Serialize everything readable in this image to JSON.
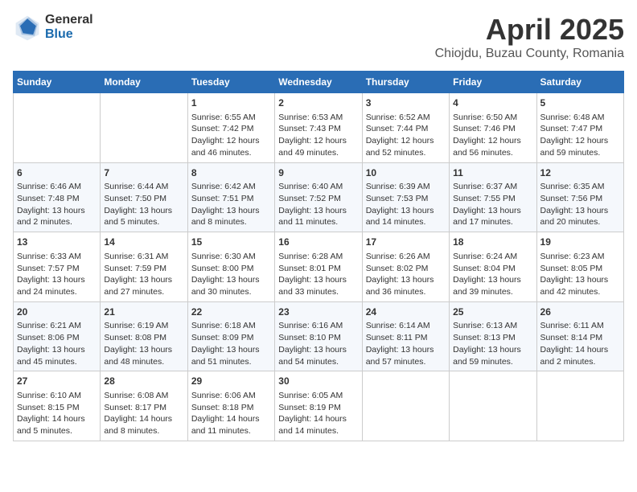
{
  "logo": {
    "general": "General",
    "blue": "Blue"
  },
  "title": {
    "month": "April 2025",
    "location": "Chiojdu, Buzau County, Romania"
  },
  "weekdays": [
    "Sunday",
    "Monday",
    "Tuesday",
    "Wednesday",
    "Thursday",
    "Friday",
    "Saturday"
  ],
  "weeks": [
    [
      {
        "day": "",
        "sunrise": "",
        "sunset": "",
        "daylight": ""
      },
      {
        "day": "",
        "sunrise": "",
        "sunset": "",
        "daylight": ""
      },
      {
        "day": "1",
        "sunrise": "Sunrise: 6:55 AM",
        "sunset": "Sunset: 7:42 PM",
        "daylight": "Daylight: 12 hours and 46 minutes."
      },
      {
        "day": "2",
        "sunrise": "Sunrise: 6:53 AM",
        "sunset": "Sunset: 7:43 PM",
        "daylight": "Daylight: 12 hours and 49 minutes."
      },
      {
        "day": "3",
        "sunrise": "Sunrise: 6:52 AM",
        "sunset": "Sunset: 7:44 PM",
        "daylight": "Daylight: 12 hours and 52 minutes."
      },
      {
        "day": "4",
        "sunrise": "Sunrise: 6:50 AM",
        "sunset": "Sunset: 7:46 PM",
        "daylight": "Daylight: 12 hours and 56 minutes."
      },
      {
        "day": "5",
        "sunrise": "Sunrise: 6:48 AM",
        "sunset": "Sunset: 7:47 PM",
        "daylight": "Daylight: 12 hours and 59 minutes."
      }
    ],
    [
      {
        "day": "6",
        "sunrise": "Sunrise: 6:46 AM",
        "sunset": "Sunset: 7:48 PM",
        "daylight": "Daylight: 13 hours and 2 minutes."
      },
      {
        "day": "7",
        "sunrise": "Sunrise: 6:44 AM",
        "sunset": "Sunset: 7:50 PM",
        "daylight": "Daylight: 13 hours and 5 minutes."
      },
      {
        "day": "8",
        "sunrise": "Sunrise: 6:42 AM",
        "sunset": "Sunset: 7:51 PM",
        "daylight": "Daylight: 13 hours and 8 minutes."
      },
      {
        "day": "9",
        "sunrise": "Sunrise: 6:40 AM",
        "sunset": "Sunset: 7:52 PM",
        "daylight": "Daylight: 13 hours and 11 minutes."
      },
      {
        "day": "10",
        "sunrise": "Sunrise: 6:39 AM",
        "sunset": "Sunset: 7:53 PM",
        "daylight": "Daylight: 13 hours and 14 minutes."
      },
      {
        "day": "11",
        "sunrise": "Sunrise: 6:37 AM",
        "sunset": "Sunset: 7:55 PM",
        "daylight": "Daylight: 13 hours and 17 minutes."
      },
      {
        "day": "12",
        "sunrise": "Sunrise: 6:35 AM",
        "sunset": "Sunset: 7:56 PM",
        "daylight": "Daylight: 13 hours and 20 minutes."
      }
    ],
    [
      {
        "day": "13",
        "sunrise": "Sunrise: 6:33 AM",
        "sunset": "Sunset: 7:57 PM",
        "daylight": "Daylight: 13 hours and 24 minutes."
      },
      {
        "day": "14",
        "sunrise": "Sunrise: 6:31 AM",
        "sunset": "Sunset: 7:59 PM",
        "daylight": "Daylight: 13 hours and 27 minutes."
      },
      {
        "day": "15",
        "sunrise": "Sunrise: 6:30 AM",
        "sunset": "Sunset: 8:00 PM",
        "daylight": "Daylight: 13 hours and 30 minutes."
      },
      {
        "day": "16",
        "sunrise": "Sunrise: 6:28 AM",
        "sunset": "Sunset: 8:01 PM",
        "daylight": "Daylight: 13 hours and 33 minutes."
      },
      {
        "day": "17",
        "sunrise": "Sunrise: 6:26 AM",
        "sunset": "Sunset: 8:02 PM",
        "daylight": "Daylight: 13 hours and 36 minutes."
      },
      {
        "day": "18",
        "sunrise": "Sunrise: 6:24 AM",
        "sunset": "Sunset: 8:04 PM",
        "daylight": "Daylight: 13 hours and 39 minutes."
      },
      {
        "day": "19",
        "sunrise": "Sunrise: 6:23 AM",
        "sunset": "Sunset: 8:05 PM",
        "daylight": "Daylight: 13 hours and 42 minutes."
      }
    ],
    [
      {
        "day": "20",
        "sunrise": "Sunrise: 6:21 AM",
        "sunset": "Sunset: 8:06 PM",
        "daylight": "Daylight: 13 hours and 45 minutes."
      },
      {
        "day": "21",
        "sunrise": "Sunrise: 6:19 AM",
        "sunset": "Sunset: 8:08 PM",
        "daylight": "Daylight: 13 hours and 48 minutes."
      },
      {
        "day": "22",
        "sunrise": "Sunrise: 6:18 AM",
        "sunset": "Sunset: 8:09 PM",
        "daylight": "Daylight: 13 hours and 51 minutes."
      },
      {
        "day": "23",
        "sunrise": "Sunrise: 6:16 AM",
        "sunset": "Sunset: 8:10 PM",
        "daylight": "Daylight: 13 hours and 54 minutes."
      },
      {
        "day": "24",
        "sunrise": "Sunrise: 6:14 AM",
        "sunset": "Sunset: 8:11 PM",
        "daylight": "Daylight: 13 hours and 57 minutes."
      },
      {
        "day": "25",
        "sunrise": "Sunrise: 6:13 AM",
        "sunset": "Sunset: 8:13 PM",
        "daylight": "Daylight: 13 hours and 59 minutes."
      },
      {
        "day": "26",
        "sunrise": "Sunrise: 6:11 AM",
        "sunset": "Sunset: 8:14 PM",
        "daylight": "Daylight: 14 hours and 2 minutes."
      }
    ],
    [
      {
        "day": "27",
        "sunrise": "Sunrise: 6:10 AM",
        "sunset": "Sunset: 8:15 PM",
        "daylight": "Daylight: 14 hours and 5 minutes."
      },
      {
        "day": "28",
        "sunrise": "Sunrise: 6:08 AM",
        "sunset": "Sunset: 8:17 PM",
        "daylight": "Daylight: 14 hours and 8 minutes."
      },
      {
        "day": "29",
        "sunrise": "Sunrise: 6:06 AM",
        "sunset": "Sunset: 8:18 PM",
        "daylight": "Daylight: 14 hours and 11 minutes."
      },
      {
        "day": "30",
        "sunrise": "Sunrise: 6:05 AM",
        "sunset": "Sunset: 8:19 PM",
        "daylight": "Daylight: 14 hours and 14 minutes."
      },
      {
        "day": "",
        "sunrise": "",
        "sunset": "",
        "daylight": ""
      },
      {
        "day": "",
        "sunrise": "",
        "sunset": "",
        "daylight": ""
      },
      {
        "day": "",
        "sunrise": "",
        "sunset": "",
        "daylight": ""
      }
    ]
  ]
}
